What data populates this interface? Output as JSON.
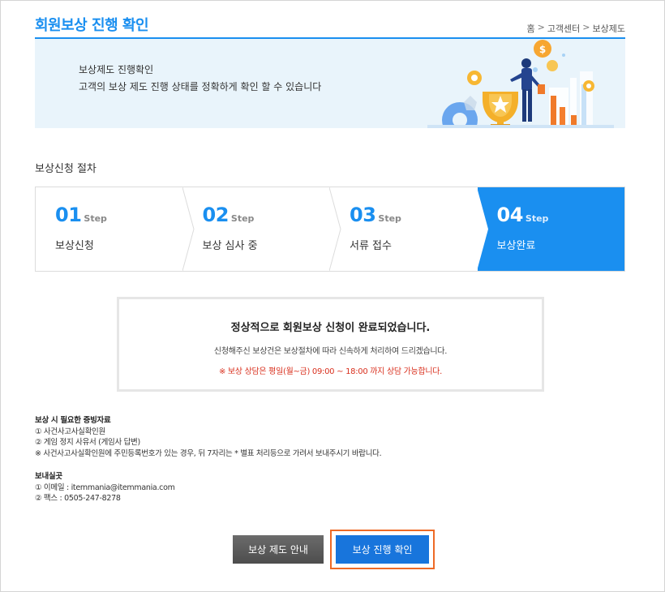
{
  "header": {
    "title": "회원보상 진행 확인",
    "breadcrumb": [
      "홈",
      "고객센터",
      "보상제도"
    ],
    "breadcrumb_sep": ">"
  },
  "banner": {
    "title": "보상제도 진행확인",
    "description": "고객의 보상 제도 진행 상태를 정확하게 확인 할 수 있습니다"
  },
  "procedure": {
    "title": "보상신청 절차",
    "step_word": "Step",
    "active_index": 3,
    "steps": [
      {
        "num": "01",
        "label": "보상신청"
      },
      {
        "num": "02",
        "label": "보상 심사 중"
      },
      {
        "num": "03",
        "label": "서류 접수"
      },
      {
        "num": "04",
        "label": "보상완료"
      }
    ]
  },
  "notice": {
    "title": "정상적으로 회원보상 신청이 완료되었습니다.",
    "description": "신청해주신 보상건은 보상절차에 따라 신속하게 처리하여 드리겠습니다.",
    "hours": "※ 보상 상담은 평일(월~금) 09:00 ~ 18:00 까지 상담 가능합니다."
  },
  "documents": {
    "title": "보상 시 필요한 증빙자료",
    "items": [
      "① 사건사고사실확인원",
      "② 게임 정지 사유서 (게임사 답변)",
      "※ 사건사고사실확인원에 주민등록번호가 있는 경우, 뒤 7자리는 * 별표 처리등으로 가려서 보내주시기 바랍니다."
    ]
  },
  "send_to": {
    "title": "보내실곳",
    "items": [
      "① 이메일 : itemmania@itemmania.com",
      "② 팩스 : 0505-247-8278"
    ]
  },
  "buttons": {
    "guide": "보상 제도 안내",
    "confirm": "보상 진행 확인"
  },
  "colors": {
    "accent": "#1a8ff0",
    "confirm_button": "#1875dc",
    "highlight_border": "#ee6a26",
    "warning_text": "#d9301e"
  }
}
